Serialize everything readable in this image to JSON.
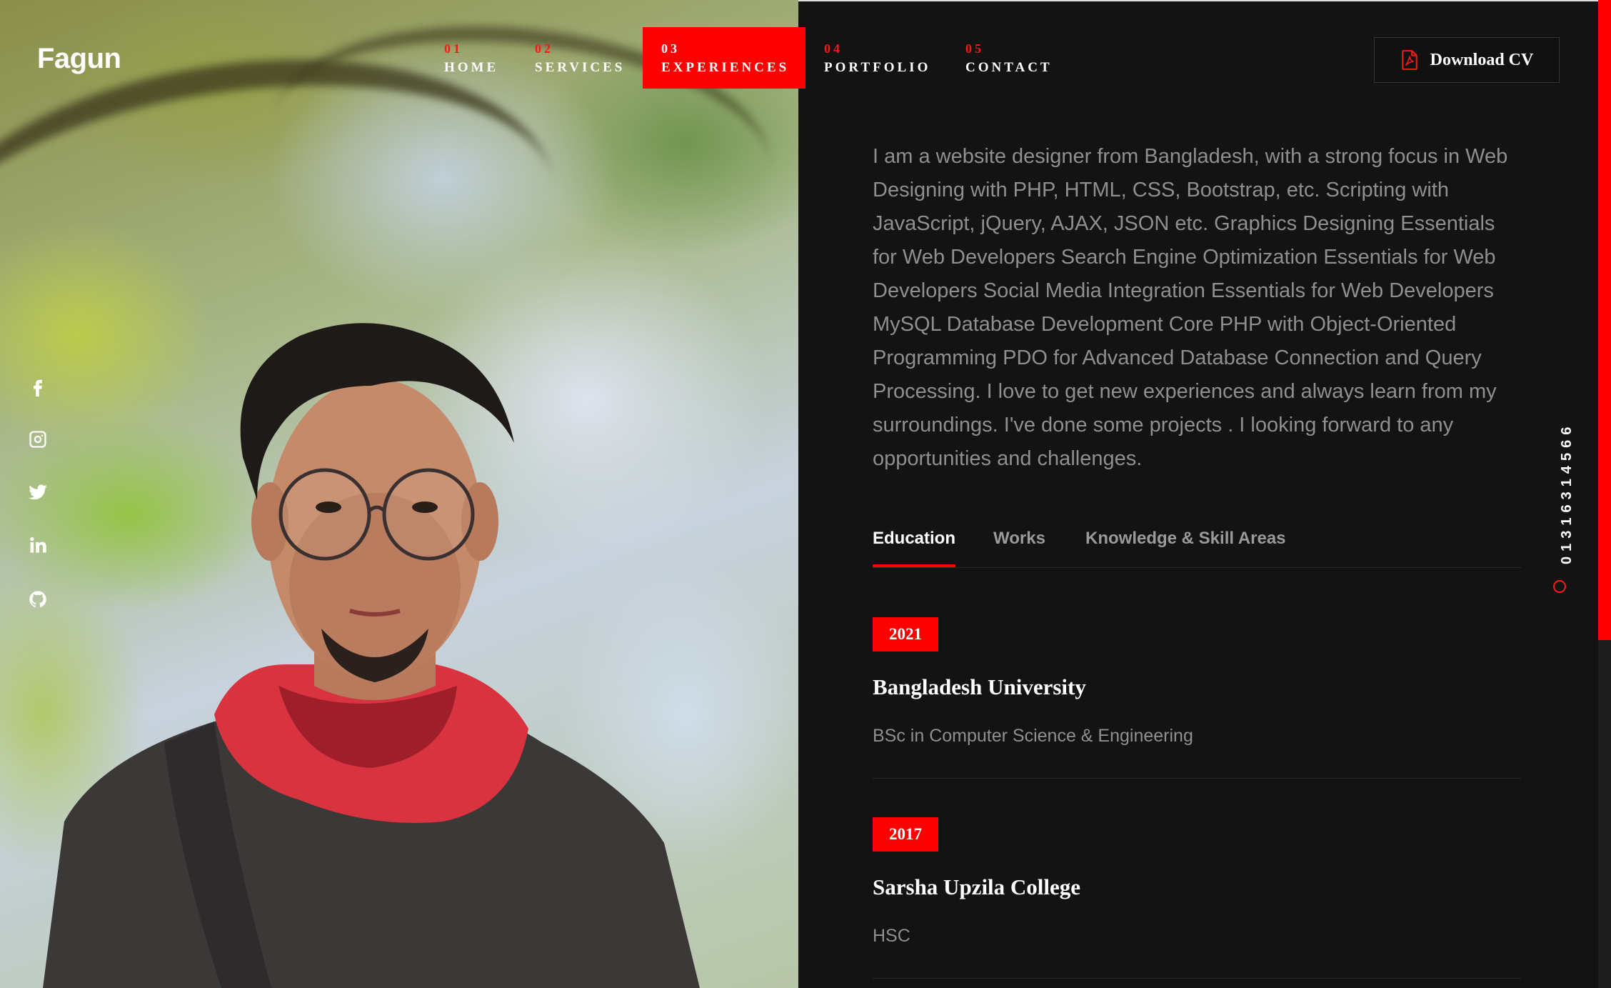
{
  "brand": {
    "logo": "Fagun"
  },
  "nav": [
    {
      "num": "01",
      "label": "HOME"
    },
    {
      "num": "02",
      "label": "SERVICES"
    },
    {
      "num": "03",
      "label": "EXPERIENCES"
    },
    {
      "num": "04",
      "label": "PORTFOLIO"
    },
    {
      "num": "05",
      "label": "CONTACT"
    }
  ],
  "download": {
    "label": "Download CV",
    "icon": "pdf-file-icon"
  },
  "social": [
    "facebook-icon",
    "instagram-icon",
    "twitter-icon",
    "linkedin-icon",
    "github-icon"
  ],
  "phone": "01316314566",
  "about": "I am a website designer from Bangladesh, with a strong focus in Web Designing with PHP, HTML, CSS, Bootstrap, etc. Scripting with JavaScript, jQuery, AJAX, JSON etc. Graphics Designing Essentials for Web Developers Search Engine Optimization Essentials for Web Developers Social Media Integration Essentials for Web Developers MySQL Database Development Core PHP with Object-Oriented Programming PDO for Advanced Database Connection and Query Processing. I love to get new experiences and always learn from my surroundings. I've done some projects . I looking forward to any opportunities and challenges.",
  "tabs": [
    "Education",
    "Works",
    "Knowledge & Skill Areas"
  ],
  "active_tab": "Education",
  "active_nav": "EXPERIENCES",
  "education": [
    {
      "year": "2021",
      "institution": "Bangladesh University",
      "degree": "BSc in Computer Science & Engineering"
    },
    {
      "year": "2017",
      "institution": "Sarsha Upzila College",
      "degree": "HSC"
    }
  ],
  "colors": {
    "accent": "#ff0000",
    "background": "#131313",
    "text_muted": "#8f8f8f"
  }
}
